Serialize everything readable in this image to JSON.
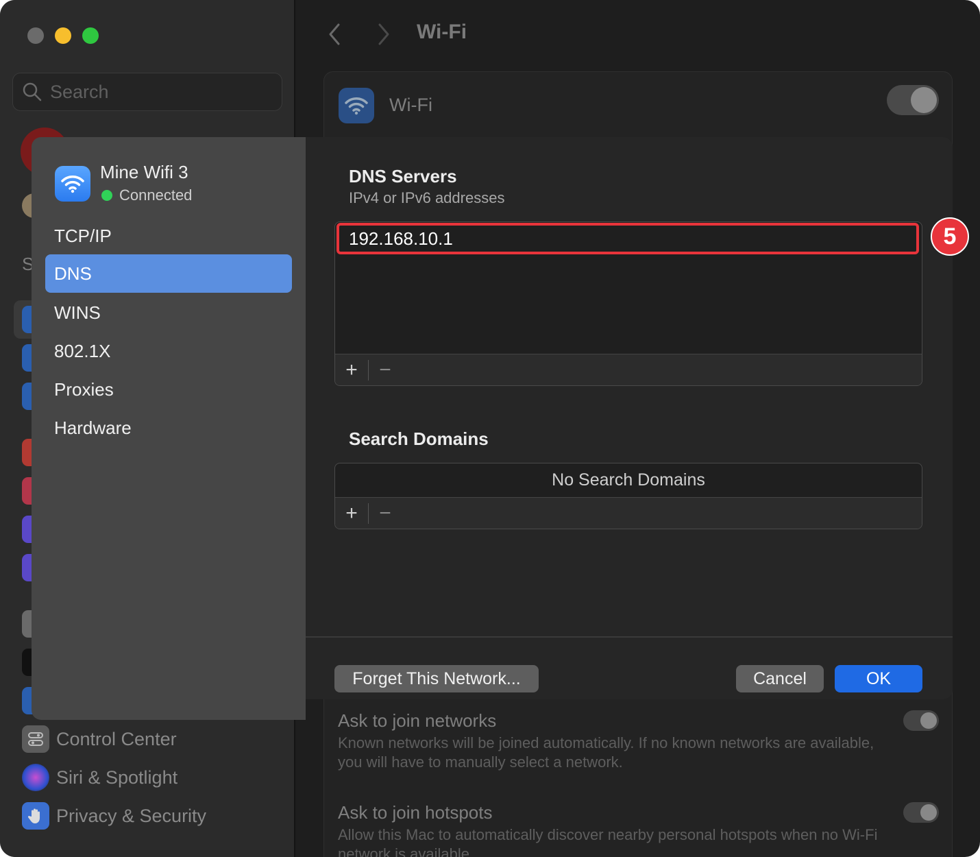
{
  "window": {
    "title": "Wi-Fi",
    "search_placeholder": "Search"
  },
  "sidebar": {
    "partial_letter": "S",
    "items": [
      {
        "label": "Control Center",
        "icon": "control-center-icon"
      },
      {
        "label": "Siri & Spotlight",
        "icon": "siri-icon"
      },
      {
        "label": "Privacy & Security",
        "icon": "hand-icon"
      }
    ]
  },
  "main": {
    "wifi_label": "Wi-Fi",
    "ask_networks_heading": "Ask to join networks",
    "ask_networks_desc": "Known networks will be joined automatically. If no known networks are available, you will have to manually select a network.",
    "ask_hotspots_heading": "Ask to join hotspots",
    "ask_hotspots_desc": "Allow this Mac to automatically discover nearby personal hotspots when no Wi-Fi network is available."
  },
  "sheet": {
    "network_name": "Mine Wifi 3",
    "network_status": "Connected",
    "tabs": [
      "TCP/IP",
      "DNS",
      "WINS",
      "802.1X",
      "Proxies",
      "Hardware"
    ],
    "active_tab": "DNS",
    "dns": {
      "title": "DNS Servers",
      "subtitle": "IPv4 or IPv6 addresses",
      "entries": [
        "192.168.10.1"
      ]
    },
    "search_domains": {
      "title": "Search Domains",
      "empty_text": "No Search Domains"
    },
    "add_symbol": "+",
    "remove_symbol": "−",
    "buttons": {
      "forget": "Forget This Network...",
      "cancel": "Cancel",
      "ok": "OK"
    },
    "step_badge": "5"
  },
  "colors": {
    "accent": "#1f6ae4",
    "selected_tab": "#5b8fe0",
    "highlight": "#e8343b",
    "connected": "#30d158"
  }
}
